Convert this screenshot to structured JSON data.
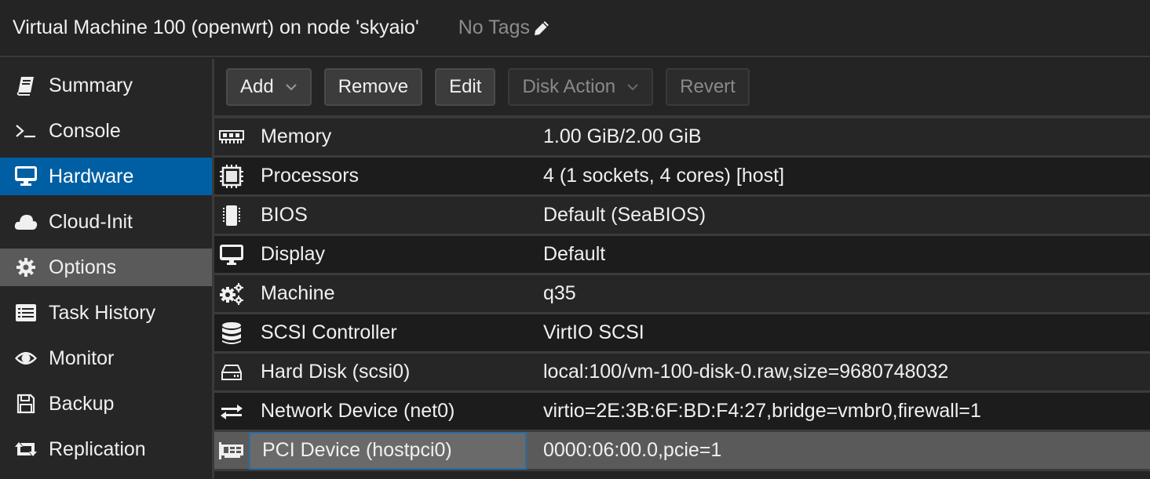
{
  "header": {
    "title": "Virtual Machine 100 (openwrt) on node 'skyaio'",
    "tags_label": "No Tags",
    "tags_icon": "pencil-icon"
  },
  "sidebar": {
    "items": [
      {
        "label": "Summary",
        "icon": "book-icon",
        "state": "normal"
      },
      {
        "label": "Console",
        "icon": "terminal-icon",
        "state": "normal"
      },
      {
        "label": "Hardware",
        "icon": "desktop-icon",
        "state": "active"
      },
      {
        "label": "Cloud-Init",
        "icon": "cloud-icon",
        "state": "normal"
      },
      {
        "label": "Options",
        "icon": "gear-icon",
        "state": "hover"
      },
      {
        "label": "Task History",
        "icon": "list-icon",
        "state": "normal"
      },
      {
        "label": "Monitor",
        "icon": "eye-icon",
        "state": "normal"
      },
      {
        "label": "Backup",
        "icon": "floppy-icon",
        "state": "normal"
      },
      {
        "label": "Replication",
        "icon": "retweet-icon",
        "state": "normal"
      }
    ]
  },
  "toolbar": {
    "add_label": "Add",
    "remove_label": "Remove",
    "edit_label": "Edit",
    "disk_action_label": "Disk Action",
    "revert_label": "Revert"
  },
  "hardware": {
    "rows": [
      {
        "key": "Memory",
        "value": "1.00 GiB/2.00 GiB",
        "icon": "memory-icon"
      },
      {
        "key": "Processors",
        "value": "4 (1 sockets, 4 cores) [host]",
        "icon": "cpu-icon"
      },
      {
        "key": "BIOS",
        "value": "Default (SeaBIOS)",
        "icon": "microchip-icon"
      },
      {
        "key": "Display",
        "value": "Default",
        "icon": "desktop-icon"
      },
      {
        "key": "Machine",
        "value": "q35",
        "icon": "cogs-icon"
      },
      {
        "key": "SCSI Controller",
        "value": "VirtIO SCSI",
        "icon": "database-icon"
      },
      {
        "key": "Hard Disk (scsi0)",
        "value": "local:100/vm-100-disk-0.raw,size=9680748032",
        "icon": "hdd-icon"
      },
      {
        "key": "Network Device (net0)",
        "value": "virtio=2E:3B:6F:BD:F4:27,bridge=vmbr0,firewall=1",
        "icon": "exchange-icon"
      },
      {
        "key": "PCI Device (hostpci0)",
        "value": "0000:06:00.0,pcie=1",
        "icon": "pci-card-icon",
        "selected": true
      }
    ]
  },
  "colors": {
    "accent": "#005fa3",
    "hover": "#5a5a5a",
    "selected_border": "#2a6da3"
  }
}
